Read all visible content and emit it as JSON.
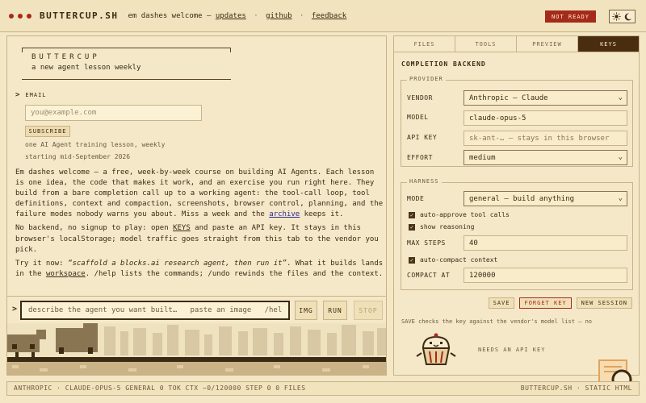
{
  "header": {
    "brand": "BUTTERCUP.SH",
    "tagline": "em dashes welcome —",
    "links": [
      "updates",
      "github",
      "feedback"
    ],
    "separator": "·",
    "status": "NOT READY",
    "status_color": "#a52a1a",
    "theme_icons": [
      "sun-icon",
      "moon-icon"
    ]
  },
  "hero": {
    "title": "BUTTERCUP",
    "subtitle": "a new agent lesson weekly"
  },
  "email": {
    "label": "EMAIL",
    "placeholder": "you@example.com",
    "subscribe": "SUBSCRIBE",
    "note1": "one AI Agent training lesson, weekly",
    "note2": "starting mid-September 2026"
  },
  "prose": {
    "p1_a": "Em dashes welcome — a free, week-by-week course on building AI Agents. Each lesson is one idea, the code that makes it work, and an exercise you run right here. They build from a bare completion call up to a working agent: the tool-call loop, tool definitions, context and compaction, screenshots, browser control, planning, and the failure modes nobody warns you about. Miss a week and the ",
    "p1_link": "archive",
    "p1_b": " keeps it.",
    "p2_a": "No backend, no signup to play: open ",
    "p2_link": "KEYS",
    "p2_b": " and paste an API key. It stays in this browser's ",
    "p2_code": "localStorage",
    "p2_c": "; model traffic goes straight from this tab to the vendor you pick.",
    "p3_a": "Try it now: ",
    "p3_em": "“scaffold a blocks.ai research agent, then run it”",
    "p3_b": ". What it builds lands in the ",
    "p3_link": "workspace",
    "p3_c": ". /help lists the commands; /undo rewinds the files and the context."
  },
  "prompt": {
    "placeholder": "describe the agent you want built…   paste an image   /help",
    "img": "IMG",
    "run": "RUN",
    "stop": "STOP"
  },
  "tabs": [
    {
      "label": "FILES"
    },
    {
      "label": "TOOLS"
    },
    {
      "label": "PREVIEW"
    },
    {
      "label": "KEYS",
      "active": true
    }
  ],
  "backend": {
    "title": "COMPLETION BACKEND",
    "provider_legend": "PROVIDER",
    "vendor_label": "VENDOR",
    "vendor_value": "Anthropic — Claude",
    "model_label": "MODEL",
    "model_value": "claude-opus-5",
    "apikey_label": "API KEY",
    "apikey_placeholder": "sk-ant-… — stays in this browser",
    "effort_label": "EFFORT",
    "effort_value": "medium",
    "harness_legend": "HARNESS",
    "mode_label": "MODE",
    "mode_value": "general — build anything",
    "auto_approve": "auto-approve tool calls",
    "show_reasoning": "show reasoning",
    "max_steps_label": "MAX STEPS",
    "max_steps_value": "40",
    "auto_compact": "auto-compact context",
    "compact_label": "COMPACT AT",
    "compact_value": "120000",
    "save": "SAVE",
    "forget": "FORGET KEY",
    "new_session": "NEW SESSION",
    "save_note": "SAVE checks the key against the vendor's model list — no",
    "api_note": "NEEDS AN API KEY"
  },
  "statusbar": {
    "left": "ANTHROPIC · CLAUDE-OPUS-5  GENERAL  0 TOK  CTX ~0/120000  STEP 0  0 FILES",
    "right": "BUTTERCUP.SH · STATIC HTML"
  }
}
